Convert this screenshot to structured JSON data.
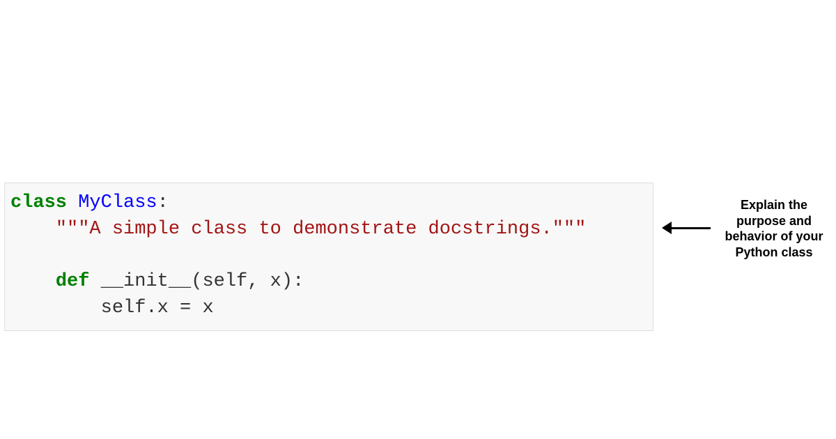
{
  "code": {
    "kw_class": "class",
    "class_name": "MyClass",
    "colon": ":",
    "docstring_open": "\"\"\"",
    "docstring_text": "A simple class to demonstrate docstrings.",
    "docstring_close": "\"\"\"",
    "kw_def": "def",
    "method_name": "__init__",
    "method_params": "(self, x):",
    "body_line": "self.x = x"
  },
  "annotation": {
    "text": "Explain the purpose and behavior of your Python class"
  }
}
